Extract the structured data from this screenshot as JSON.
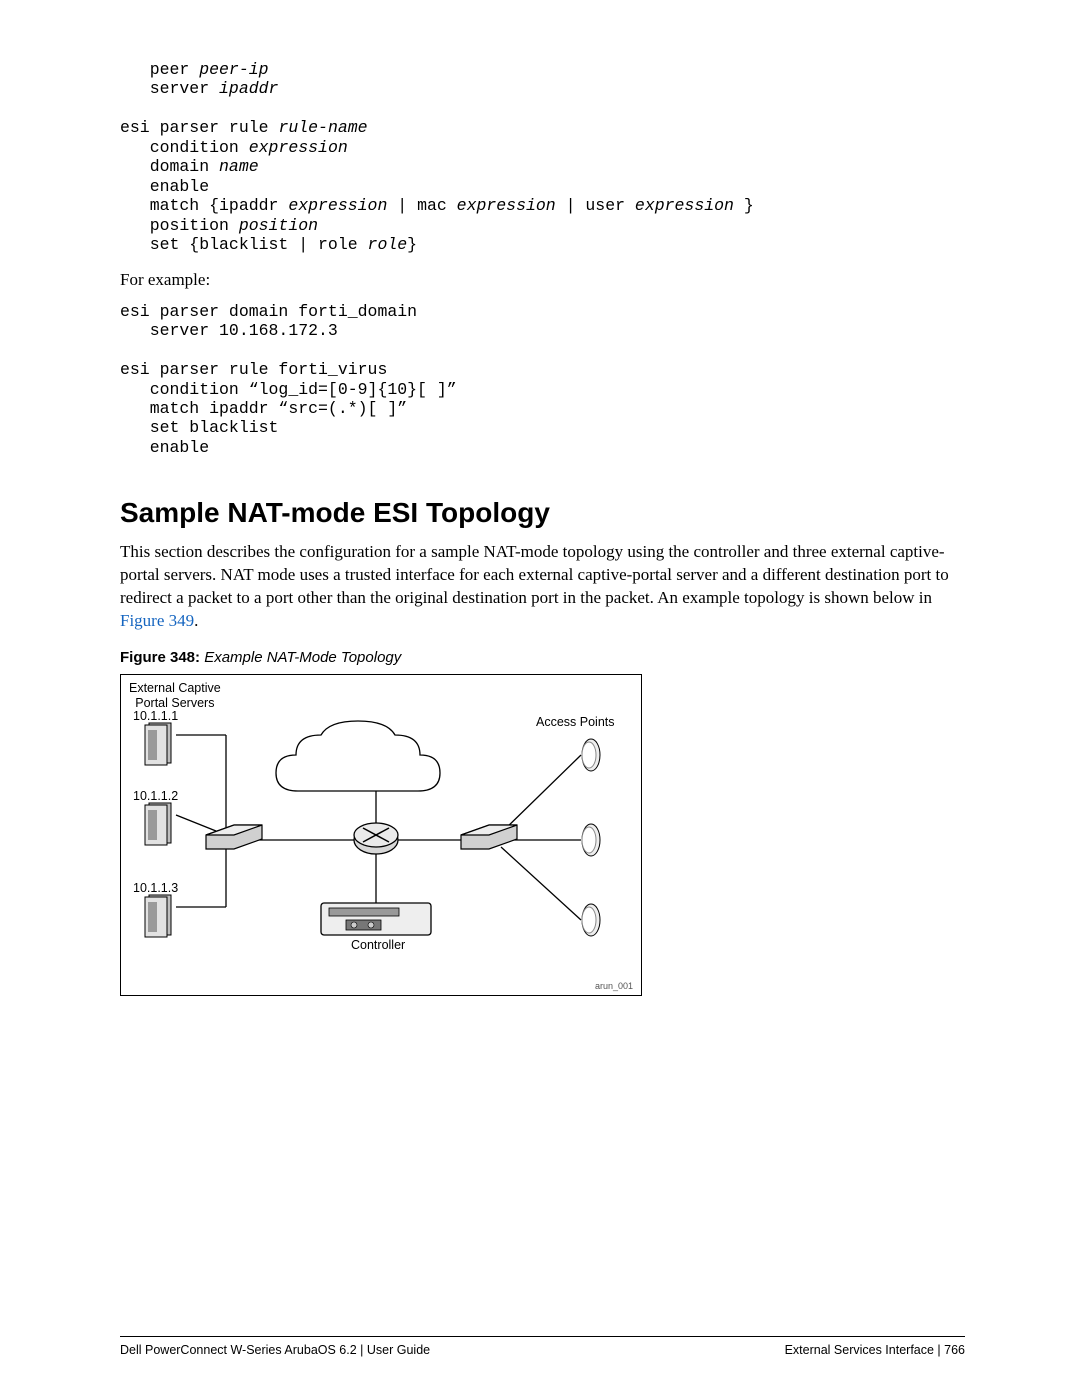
{
  "code_block_1_html": "   peer <em>peer-ip</em>\n   server <em>ipaddr</em>\n\nesi parser rule <em>rule-name</em>\n   condition <em>expression</em>\n   domain <em>name</em>\n   enable\n   match {ipaddr <em>expression</em> | mac <em>expression</em> | user <em>expression</em> }\n   position <em>position</em>\n   set {blacklist | role <em>role</em>}",
  "for_example": "For example:",
  "code_block_2": "esi parser domain forti_domain\n   server 10.168.172.3\n\nesi parser rule forti_virus\n   condition “log_id=[0-9]{10}[ ]”\n   match ipaddr “src=(.*)[ ]”\n   set blacklist\n   enable",
  "heading": "Sample NAT-mode ESI Topology",
  "paragraph_part1": "This section describes the configuration for a sample NAT-mode topology using the controller and three external captive-portal servers. NAT mode uses a trusted interface for each external captive-portal server and a different destination port to redirect a packet to a port other than the original destination port in the packet. An example topology is shown below in ",
  "paragraph_link": "Figure 349",
  "paragraph_part2": ".",
  "figure": {
    "num": "Figure 348:",
    "title": " Example NAT-Mode Topology",
    "labels": {
      "ecp_title": "External Captive\nPortal Servers",
      "ip1": "10.1.1.1",
      "ip2": "10.1.1.2",
      "ip3": "10.1.1.3",
      "ap": "Access Points",
      "controller": "Controller",
      "tag": "arun_001"
    }
  },
  "footer": {
    "left": "Dell PowerConnect W-Series ArubaOS 6.2 | User Guide",
    "right": "External Services Interface | 766"
  }
}
